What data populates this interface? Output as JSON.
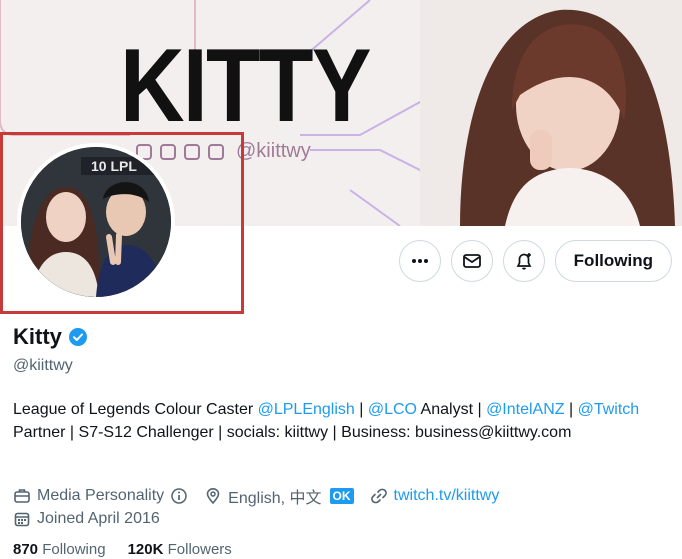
{
  "banner": {
    "title": "KITTY",
    "social_handle": "@kiittwy"
  },
  "actions": {
    "more_icon": "ellipsis-icon",
    "message_icon": "envelope-icon",
    "notify_icon": "bell-plus-icon",
    "follow_label": "Following"
  },
  "profile": {
    "name": "Kitty",
    "handle": "@kiittwy",
    "verified_color": "#1d9bf0"
  },
  "bio": {
    "t1": "League of Legends Colour Caster ",
    "m1": "@LPLEnglish",
    "t2": " | ",
    "m2": "@LCO",
    "t3": " Analyst | ",
    "m3": "@IntelANZ",
    "t4": " | ",
    "m4": "@Twitch",
    "t5": " Partner | S7-S12 Challenger | socials: kiittwy | Business: business@kiittwy.com"
  },
  "meta": {
    "category": "Media Personality",
    "location": "English, 中文",
    "location_badge": "OK",
    "website": "twitch.tv/kiittwy",
    "joined": "Joined April 2016"
  },
  "stats": {
    "following_count": "870",
    "following_label": "Following",
    "followers_count": "120K",
    "followers_label": "Followers"
  },
  "colors": {
    "accent": "#1d9bf0",
    "highlight_box": "#c63a3a"
  }
}
